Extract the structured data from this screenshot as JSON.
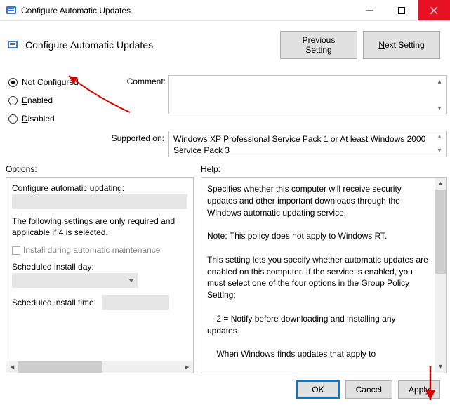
{
  "window": {
    "title": "Configure Automatic Updates"
  },
  "header": {
    "title": "Configure Automatic Updates",
    "prev_button": "Previous Setting",
    "next_button": "Next Setting"
  },
  "radios": {
    "not_configured": "Not Configured",
    "enabled": "Enabled",
    "disabled": "Disabled",
    "selected": "not_configured"
  },
  "comment": {
    "label": "Comment:",
    "value": ""
  },
  "supported": {
    "label": "Supported on:",
    "value": "Windows XP Professional Service Pack 1 or At least Windows 2000 Service Pack 3"
  },
  "panes": {
    "options_label": "Options:",
    "help_label": "Help:"
  },
  "options": {
    "configure_label": "Configure automatic updating:",
    "configure_value": "",
    "required_note": "The following settings are only required and applicable if 4 is selected.",
    "install_maint_label": "Install during automatic maintenance",
    "install_maint_checked": false,
    "sched_day_label": "Scheduled install day:",
    "sched_day_value": "",
    "sched_time_label": "Scheduled install time:",
    "sched_time_value": ""
  },
  "help": {
    "p1": "Specifies whether this computer will receive security updates and other important downloads through the Windows automatic updating service.",
    "p2": "Note: This policy does not apply to Windows RT.",
    "p3": "This setting lets you specify whether automatic updates are enabled on this computer. If the service is enabled, you must select one of the four options in the Group Policy Setting:",
    "p4": "    2 = Notify before downloading and installing any updates.",
    "p5": "    When Windows finds updates that apply to"
  },
  "footer": {
    "ok": "OK",
    "cancel": "Cancel",
    "apply": "Apply"
  }
}
